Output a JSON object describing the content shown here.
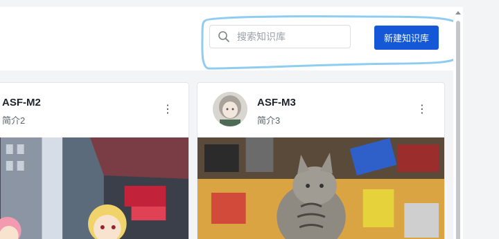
{
  "search": {
    "placeholder": "搜索知识库",
    "icon": "search-icon"
  },
  "actions": {
    "new_kb_label": "新建知识库"
  },
  "cards": [
    {
      "title": "ASF-M2",
      "description": "简介2",
      "more_icon": "more-vertical-icon"
    },
    {
      "title": "ASF-M3",
      "description": "简介3",
      "more_icon": "more-vertical-icon"
    }
  ],
  "more_glyph": "⋮",
  "colors": {
    "primary": "#1458d8",
    "annotation": "#8ecdf0",
    "background": "#f3f4f6"
  }
}
